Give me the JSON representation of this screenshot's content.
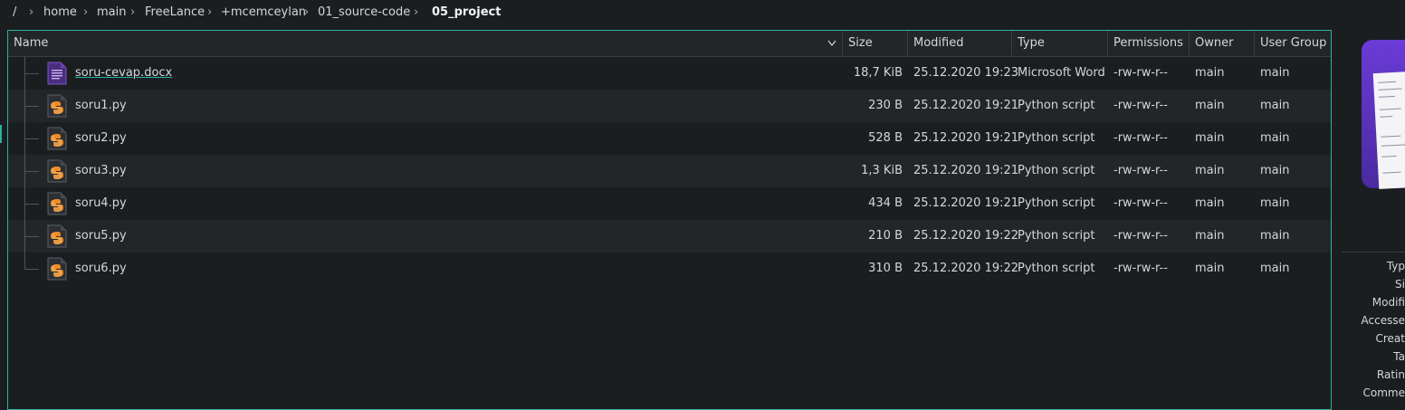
{
  "breadcrumb": {
    "items": [
      "/",
      "home",
      "main",
      "FreeLance",
      "+mcemceylan",
      "01_source-code",
      "05_project"
    ],
    "separator": "›"
  },
  "columns": {
    "name": "Name",
    "size": "Size",
    "modified": "Modified",
    "type": "Type",
    "permissions": "Permissions",
    "owner": "Owner",
    "group": "User Group"
  },
  "files": [
    {
      "name": "soru-cevap.docx",
      "size": "18,7 KiB",
      "modified": "25.12.2020 19:23",
      "type": "Microsoft Word",
      "permissions": "-rw-rw-r--",
      "owner": "main",
      "group": "main",
      "icon": "word-document-icon"
    },
    {
      "name": "soru1.py",
      "size": "230 B",
      "modified": "25.12.2020 19:21",
      "type": "Python script",
      "permissions": "-rw-rw-r--",
      "owner": "main",
      "group": "main",
      "icon": "python-file-icon"
    },
    {
      "name": "soru2.py",
      "size": "528 B",
      "modified": "25.12.2020 19:21",
      "type": "Python script",
      "permissions": "-rw-rw-r--",
      "owner": "main",
      "group": "main",
      "icon": "python-file-icon"
    },
    {
      "name": "soru3.py",
      "size": "1,3 KiB",
      "modified": "25.12.2020 19:21",
      "type": "Python script",
      "permissions": "-rw-rw-r--",
      "owner": "main",
      "group": "main",
      "icon": "python-file-icon"
    },
    {
      "name": "soru4.py",
      "size": "434 B",
      "modified": "25.12.2020 19:21",
      "type": "Python script",
      "permissions": "-rw-rw-r--",
      "owner": "main",
      "group": "main",
      "icon": "python-file-icon"
    },
    {
      "name": "soru5.py",
      "size": "210 B",
      "modified": "25.12.2020 19:22",
      "type": "Python script",
      "permissions": "-rw-rw-r--",
      "owner": "main",
      "group": "main",
      "icon": "python-file-icon"
    },
    {
      "name": "soru6.py",
      "size": "310 B",
      "modified": "25.12.2020 19:22",
      "type": "Python script",
      "permissions": "-rw-rw-r--",
      "owner": "main",
      "group": "main",
      "icon": "python-file-icon"
    }
  ],
  "info_panel": {
    "labels": [
      "Typ",
      "Si",
      "Modifi",
      "Accesse",
      "Creat",
      "Ta",
      "Ratin",
      "Comme"
    ]
  },
  "colors": {
    "accent": "#2bb2a4",
    "background": "#1b1e20",
    "alt_row": "#232629",
    "python_orange": "#f08a24",
    "word_purple": "#6b3bd6"
  }
}
